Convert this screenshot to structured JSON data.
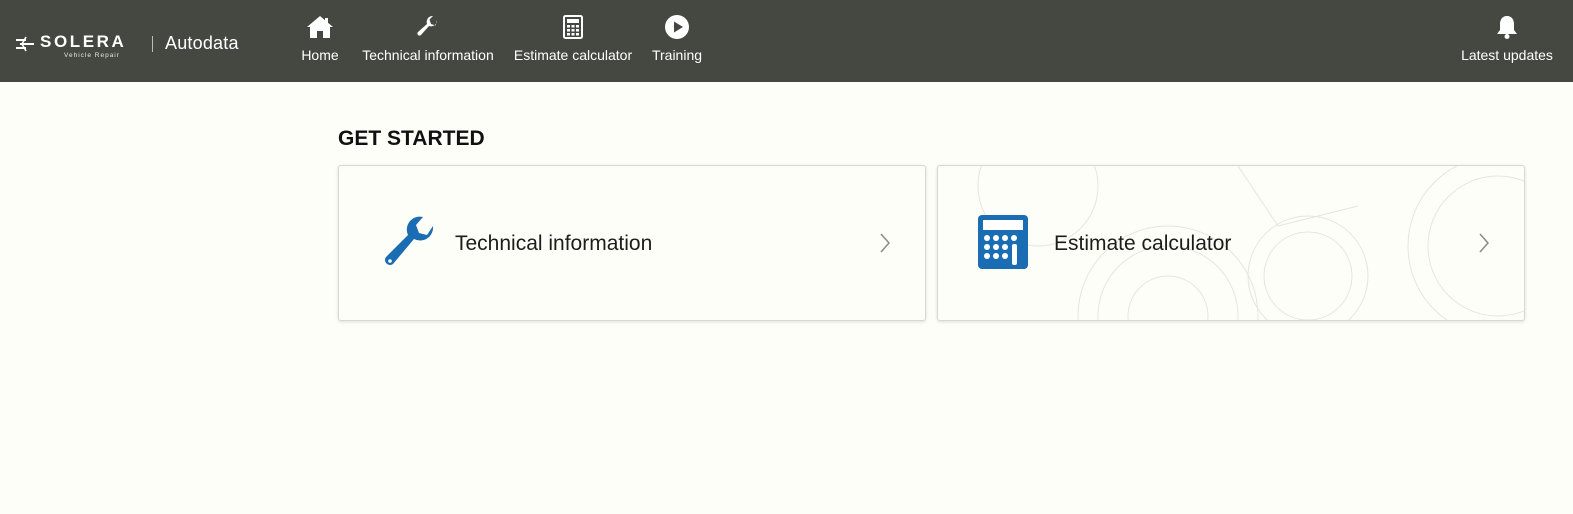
{
  "header": {
    "brand": "SOLERA",
    "brand_sub": "Vehicle Repair",
    "product": "Autodata",
    "nav": [
      {
        "label": "Home",
        "icon": "home-icon"
      },
      {
        "label": "Technical information",
        "icon": "wrench-icon"
      },
      {
        "label": "Estimate calculator",
        "icon": "calculator-icon"
      },
      {
        "label": "Training",
        "icon": "play-circle-icon"
      }
    ],
    "updates": {
      "label": "Latest updates",
      "icon": "bell-icon"
    }
  },
  "main": {
    "section_title": "GET STARTED",
    "cards": [
      {
        "label": "Technical information",
        "icon": "wrench-icon"
      },
      {
        "label": "Estimate calculator",
        "icon": "calculator-icon"
      }
    ]
  },
  "colors": {
    "header_bg": "#454841",
    "page_bg": "#fefef8",
    "accent_blue": "#1a6db3"
  }
}
